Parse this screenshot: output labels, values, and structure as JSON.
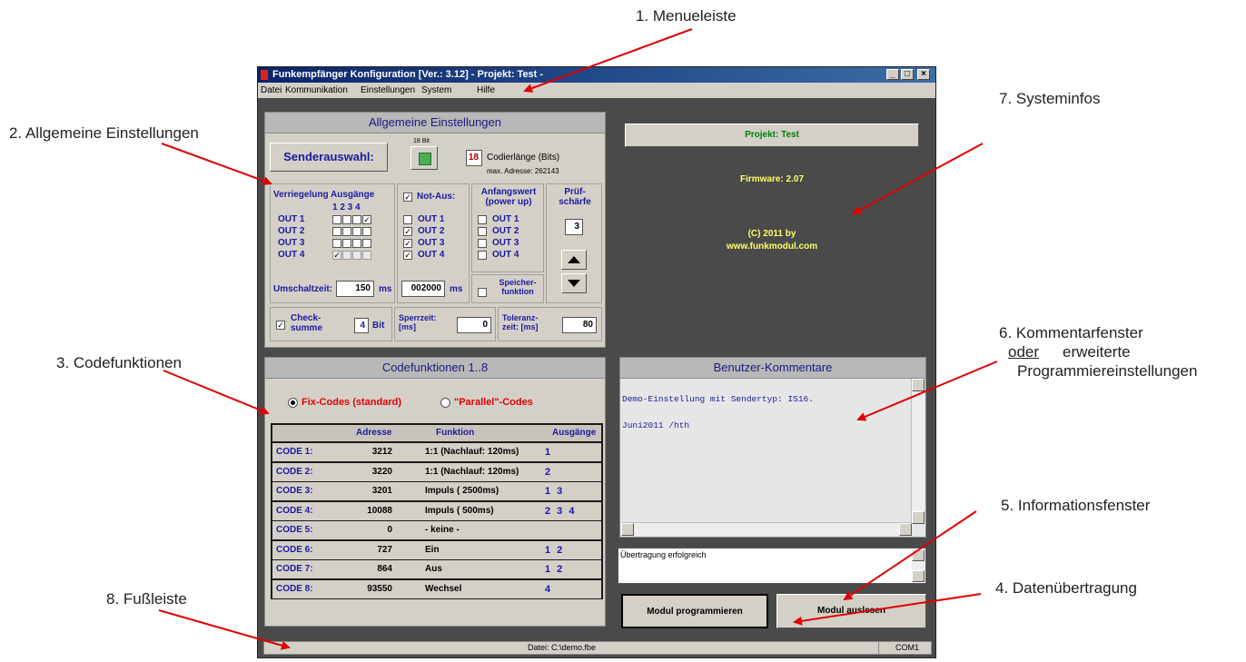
{
  "annotations": {
    "menueleiste": "1. Menueleiste",
    "allgemeine": "2. Allgemeine Einstellungen",
    "codefunktionen": "3. Codefunktionen",
    "datenuebertragung": "4. Datenübertragung",
    "informationsfenster": "5. Informationsfenster",
    "kommentar_line1": "6. Kommentarfenster",
    "kommentar_oder": "oder",
    "kommentar_erweiterte": "erweiterte",
    "kommentar_line3": "Programmiereinstellungen",
    "systeminfos": "7. Systeminfos",
    "fussleiste": "8. Fußleiste"
  },
  "window": {
    "title": "Funkempfänger Konfiguration  [Ver.: 3.12]    - Projekt: Test -",
    "controls": [
      "_",
      "□",
      "×"
    ]
  },
  "menu": [
    "Datei",
    "Kommunikation",
    "Einstellungen",
    "System",
    "Hilfe"
  ],
  "allgemeine": {
    "header": "Allgemeine Einstellungen",
    "senderauswahl": "Senderauswahl:",
    "bit_label": "18 Bit",
    "codierlaenge_value": "18",
    "codierlaenge_label": "Codierlänge (Bits)",
    "max_adresse": "max. Adresse: 262143",
    "verriegelung_title": "Verriegelung Ausgänge",
    "col_numbers": "1  2  3  4",
    "outs": [
      "OUT 1",
      "OUT 2",
      "OUT 3",
      "OUT 4"
    ],
    "umschaltzeit_label": "Umschaltzeit:",
    "umschaltzeit_value": "150",
    "ms": "ms",
    "notaus_label": "Not-Aus:",
    "notaus_value": "002000",
    "anfangswert_title": "Anfangswert (power up)",
    "speicher_label": "Speicher- funktion",
    "pruef_title": "Prüf- schärfe",
    "pruef_value": "3",
    "checksumme_label": "Check- summe",
    "checksumme_value": "4",
    "bit": "Bit",
    "sperrzeit_label": "Sperrzeit: [ms]",
    "sperrzeit_value": "0",
    "toleranz_label": "Toleranz- zeit: [ms]",
    "toleranz_value": "80"
  },
  "codefunktionen": {
    "header": "Codefunktionen 1..8",
    "fix_label": "Fix-Codes (standard)",
    "parallel_label": "\"Parallel\"-Codes",
    "columns": [
      "Adresse",
      "Funktion",
      "Ausgänge"
    ],
    "rows": [
      {
        "code": "CODE 1:",
        "adresse": "3212",
        "funktion": "1:1 (Nachlauf:  120ms)",
        "ausgaenge": "1"
      },
      {
        "code": "CODE 2:",
        "adresse": "3220",
        "funktion": "1:1 (Nachlauf:  120ms)",
        "ausgaenge": "2"
      },
      {
        "code": "CODE 3:",
        "adresse": "3201",
        "funktion": "Impuls ( 2500ms)",
        "ausgaenge": "1  3"
      },
      {
        "code": "CODE 4:",
        "adresse": "10088",
        "funktion": "Impuls (  500ms)",
        "ausgaenge": "2 3 4"
      },
      {
        "code": "CODE 5:",
        "adresse": "0",
        "funktion": "- keine -",
        "ausgaenge": ""
      },
      {
        "code": "CODE 6:",
        "adresse": "727",
        "funktion": "Ein",
        "ausgaenge": "1 2"
      },
      {
        "code": "CODE 7:",
        "adresse": "864",
        "funktion": "Aus",
        "ausgaenge": "1 2"
      },
      {
        "code": "CODE 8:",
        "adresse": "93550",
        "funktion": "Wechsel",
        "ausgaenge": "4"
      }
    ]
  },
  "system": {
    "projekt": "Projekt: Test",
    "firmware": "Firmware:   2.07",
    "copyright": "(C)  2011 by",
    "website": "www.funkmodul.com"
  },
  "kommentar": {
    "header": "Benutzer-Kommentare",
    "line1": "Demo-Einstellung mit Sendertyp: IS16.",
    "line2": "Juni2011 /hth"
  },
  "info": {
    "text": "Übertragung erfolgreich"
  },
  "buttons": {
    "programmieren": "Modul programmieren",
    "auslesen": "Modul auslesen"
  },
  "statusbar": {
    "datei": "Datei:  C:\\demo.fbe",
    "port": "COM1"
  },
  "checks": {
    "verriegelung": [
      [
        false,
        false,
        false,
        true
      ],
      [
        false,
        false,
        false,
        false
      ],
      [
        false,
        false,
        false,
        false
      ],
      [
        true,
        false,
        false,
        false
      ]
    ],
    "notaus": [
      false,
      true,
      true,
      true
    ],
    "anfangswert": [
      false,
      false,
      false,
      false
    ],
    "speicher": false,
    "checksumme": true
  }
}
